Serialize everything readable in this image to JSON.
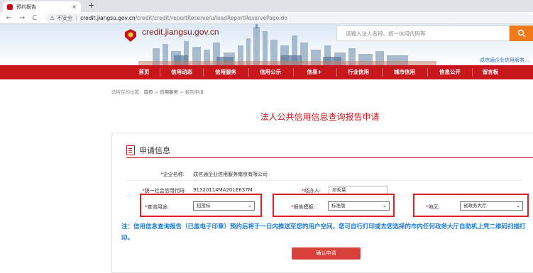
{
  "browser": {
    "tab_title": "预约报告",
    "tab_close": "×",
    "new_tab": "+",
    "back": "←",
    "forward": "→",
    "reload": "C",
    "insecure_label": "不安全",
    "url_host": "credit.jiangsu.gov.cn",
    "url_path": "/credit/credit/reportReserve/u/loadReportReservePage.do"
  },
  "header": {
    "site_name": "credit.jiangsu.gov.cn",
    "search_placeholder": "请输入法人名称、统一信用代码等",
    "service_link": "成信通企业信用服务..."
  },
  "nav": {
    "items": [
      "首页",
      "信用动态",
      "信用服务",
      "信用公示",
      "信易+",
      "行业信用",
      "城市信用",
      "信息公开",
      "留言板"
    ]
  },
  "breadcrumb": {
    "prefix": "您所在的位置：",
    "home": "首页",
    "sep1": " > ",
    "service": "信用服务",
    "sep2": " > ",
    "current": "报告申请"
  },
  "page": {
    "title": "法人公共信用信息查询报告申请"
  },
  "form": {
    "section_title": "申请信息",
    "required_mark": "*",
    "company_label": "企业名称:",
    "company_value": "成信通企业信用服务南京有限公司",
    "code_label": "统一社会信用代码:",
    "code_value": "91320114MA201E637M",
    "handler_label": "经办人:",
    "handler_value": "邓秀慧",
    "purpose_label": "查询用途:",
    "purpose_value": "招投标",
    "template_label": "报告模板:",
    "template_value": "标准版",
    "region_label": "地区:",
    "region_value": "省政务大厅",
    "chevron": "⌄"
  },
  "notice": "注：信用信息查询报告（已盖电子印章）预约后将于一日内推送至您的用户空间，您可自行打印或去您选择的市内任何政务大厅自助机上凭二维码扫描打印。",
  "submit_label": "确认申请",
  "colors": {
    "brand_red": "#c8161d",
    "notice_blue": "#1a7bd6",
    "search_orange": "#f07a1a",
    "highlight_red": "#e02020"
  }
}
